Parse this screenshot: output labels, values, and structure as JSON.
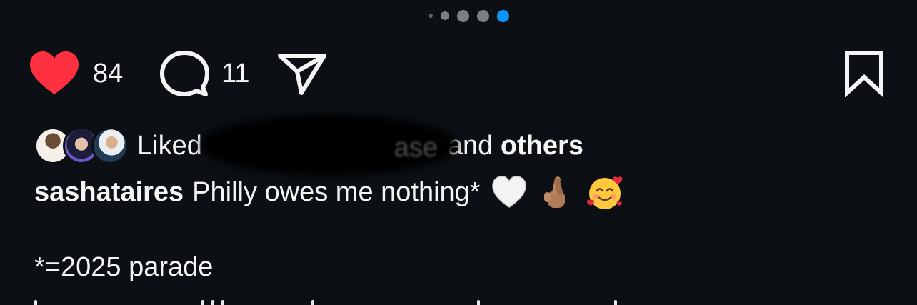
{
  "carousel": {
    "dot_count": 5,
    "active_index": 4,
    "active_color": "#0a95ff"
  },
  "actions": {
    "like_icon": "heart-filled-icon",
    "like_color": "#ff3040",
    "like_count": "84",
    "comment_icon": "comment-bubble-icon",
    "comment_count": "11",
    "share_icon": "paper-plane-icon",
    "save_icon": "bookmark-icon"
  },
  "liked_by": {
    "prefix": "Liked",
    "obscured_suffix": "ase",
    "connector": "and",
    "others": "others"
  },
  "caption": {
    "username": "sashataires",
    "text": "Philly owes me nothing*",
    "emojis": [
      "white-heart-emoji",
      "crossed-fingers-emoji",
      "smiling-face-with-hearts-emoji"
    ],
    "second_line": "*=2025 parade"
  }
}
